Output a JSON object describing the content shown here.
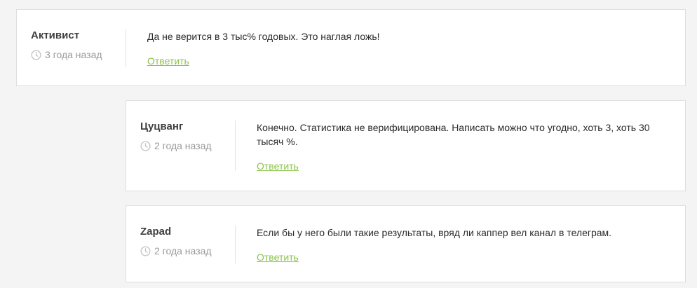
{
  "comments": [
    {
      "author": "Активист",
      "date": "3 года назад",
      "text": "Да не верится в 3 тыс% годовых. Это наглая ложь!",
      "reply_label": "Ответить"
    },
    {
      "author": "Цуцванг",
      "date": "2 года назад",
      "text": "Конечно. Статистика не верифицирована. Написать можно что угодно, хоть 3, хоть 30 тысяч %.",
      "reply_label": "Ответить"
    },
    {
      "author": "Zapad",
      "date": "2 года назад",
      "text": "Если бы у него были такие результаты, вряд ли каппер вел канал в телеграм.",
      "reply_label": "Ответить"
    }
  ],
  "icons": {
    "clock": "clock-icon"
  },
  "colors": {
    "reply_link": "#8bc34a",
    "background": "#f4f4f4"
  }
}
